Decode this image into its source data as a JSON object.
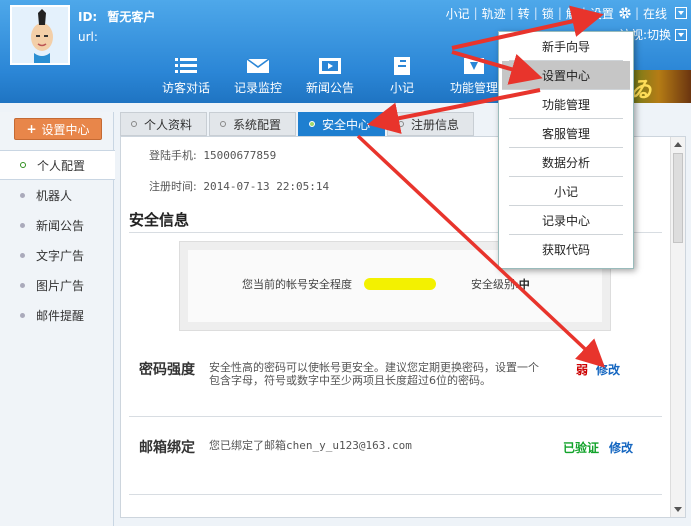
{
  "profile": {
    "id_label": "ID:",
    "id_value": "暂无客户",
    "url_label": "url:"
  },
  "toplinks": {
    "items": [
      "小记",
      "轨迹",
      "转",
      "锁",
      "解"
    ],
    "settings": "设置",
    "status": "在线",
    "switch_text": "访视:切换"
  },
  "nav": [
    "访客对话",
    "记录监控",
    "新闻公告",
    "小记",
    "功能管理"
  ],
  "sidebar": {
    "button_label": "设置中心",
    "items": [
      "个人配置",
      "机器人",
      "新闻公告",
      "文字广告",
      "图片广告",
      "邮件提醒"
    ]
  },
  "tabs": [
    "个人资料",
    "系统配置",
    "安全中心",
    "注册信息"
  ],
  "content": {
    "login_phone_label": "登陆手机:",
    "login_phone": "15000677859",
    "reg_time_label": "注册时间:",
    "reg_time": "2014-07-13 22:05:14",
    "section_title": "安全信息",
    "level_text": "您当前的帐号安全程度",
    "level_label": "安全级别:",
    "level_value": "中",
    "password": {
      "title": "密码强度",
      "desc": "安全性高的密码可以使帐号更安全。建议您定期更换密码，设置一个包含字母，符号或数字中至少两项且长度超过6位的密码。",
      "status": "弱",
      "edit": "修改"
    },
    "email": {
      "title": "邮箱绑定",
      "desc_prefix": "您已绑定了邮箱",
      "email": "chen_y_u123@163.com",
      "status": "已验证",
      "edit": "修改"
    }
  },
  "menu": [
    "新手向导",
    "设置中心",
    "功能管理",
    "客服管理",
    "数据分析",
    "小记",
    "记录中心",
    "获取代码"
  ],
  "colors": {
    "header": "#2b86d6",
    "active_tab": "#1e7fd0",
    "orange_button": "#e8864a",
    "arrow_red": "#e8342c",
    "weak": "#cc0000",
    "verified": "#12a32a",
    "link": "#1466c0",
    "level_bar": "#f3f100"
  }
}
